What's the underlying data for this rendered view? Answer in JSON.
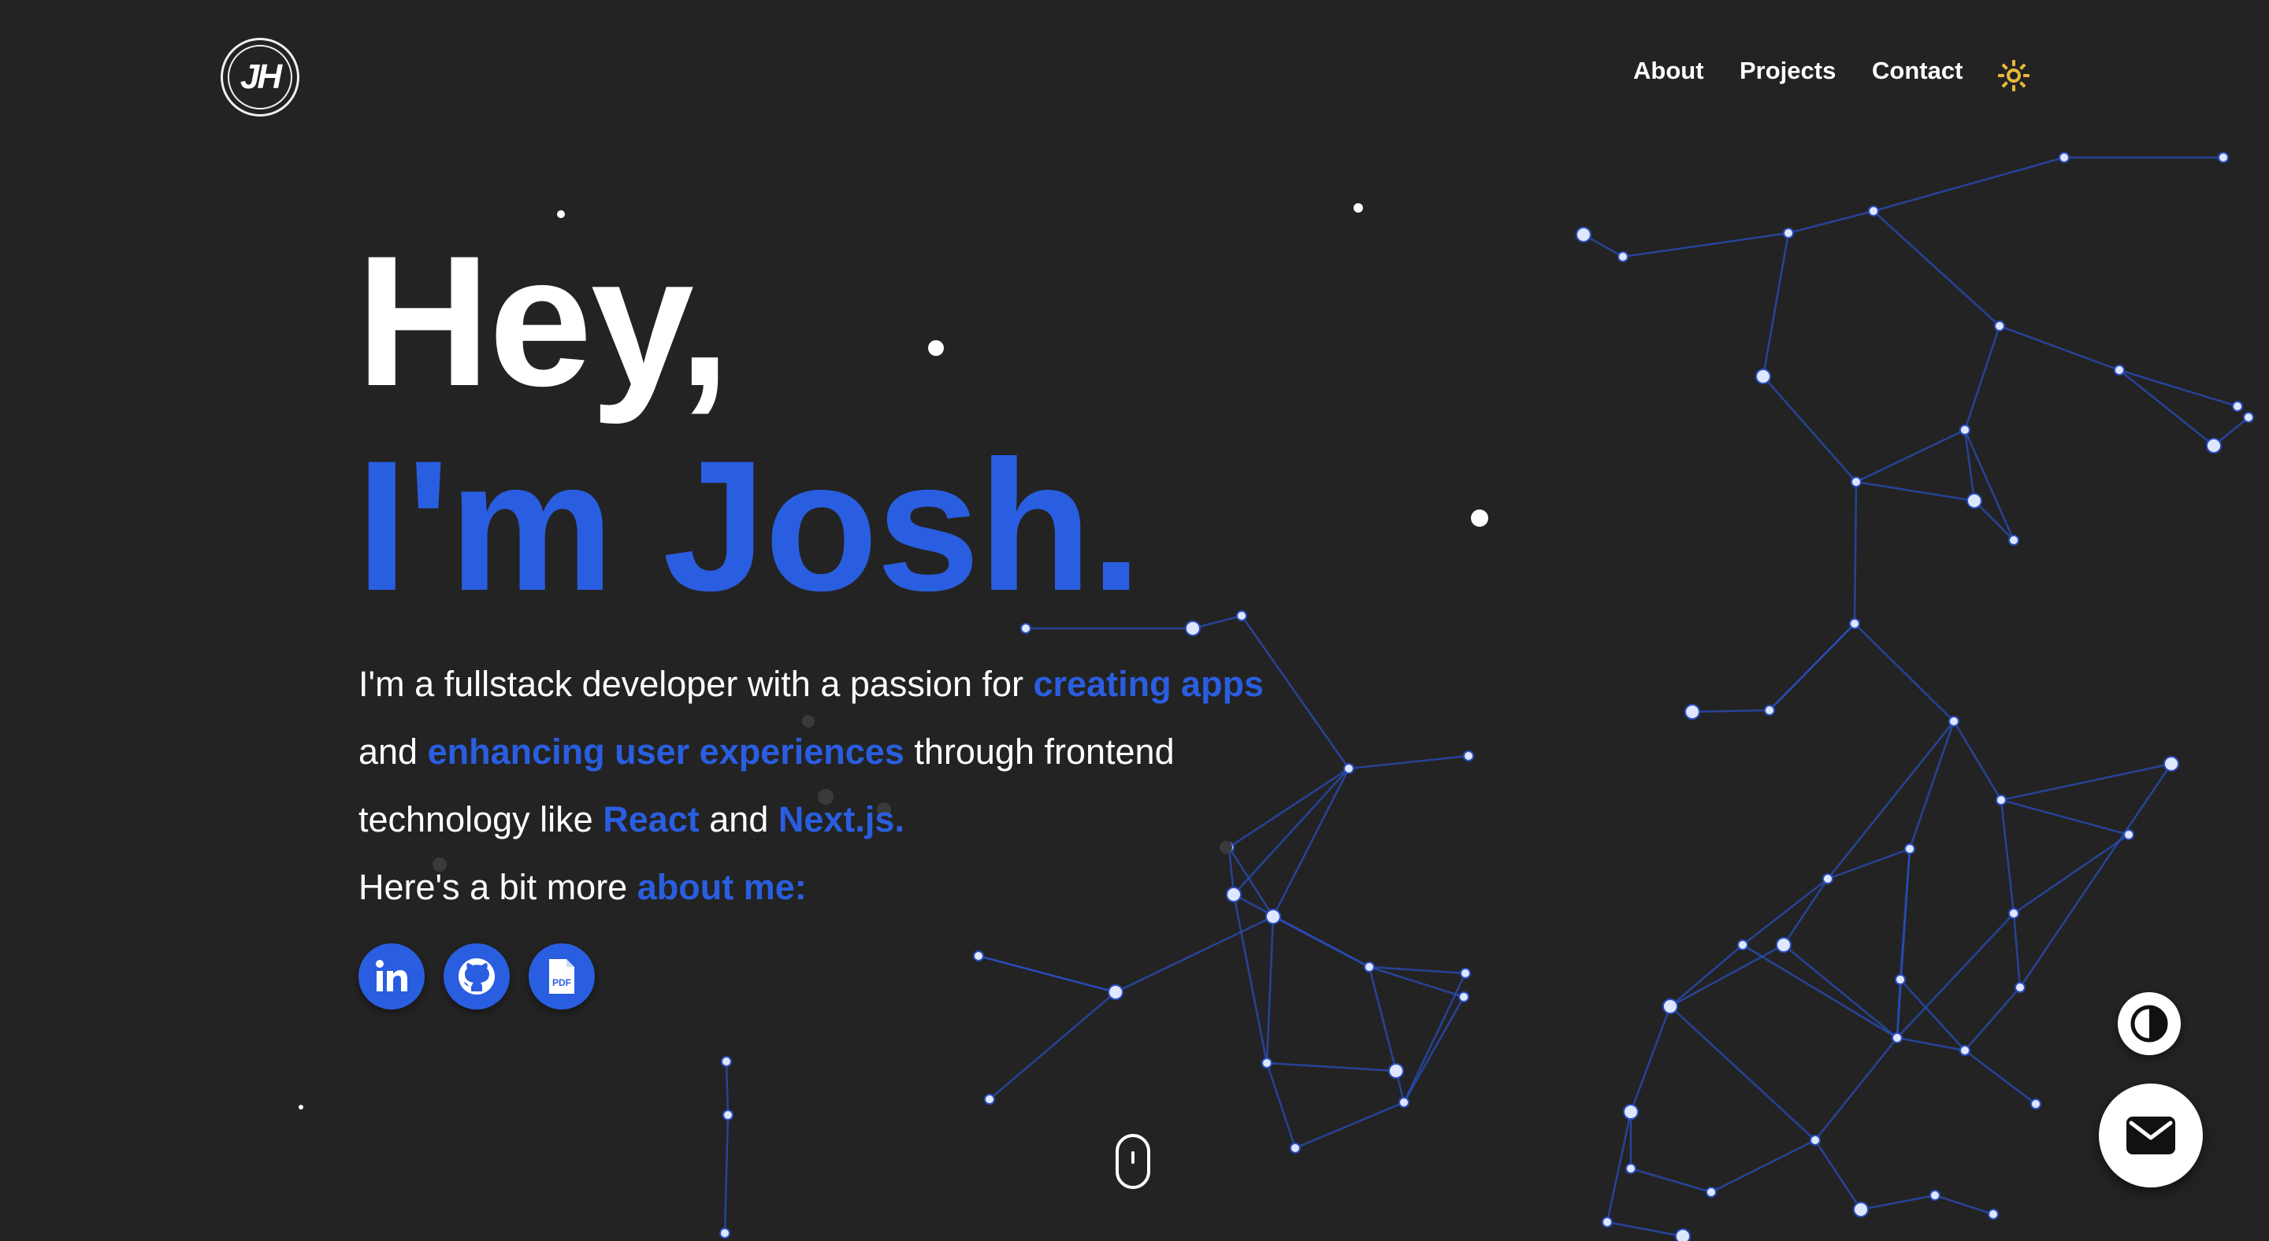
{
  "header": {
    "logo_text": "JH",
    "nav": [
      {
        "label": "About"
      },
      {
        "label": "Projects"
      },
      {
        "label": "Contact"
      }
    ],
    "theme_icon": "sun-icon"
  },
  "hero": {
    "line1": "Hey,",
    "line2": "I'm Josh.",
    "intro": {
      "t1": "I'm a fullstack developer with a passion for ",
      "h1": "creating apps",
      "t2": " and ",
      "h2": "enhancing user experiences",
      "t3": " through frontend technology like ",
      "h3": "React",
      "t4": " and ",
      "h4": "Next.js.",
      "t5": "Here's a bit more ",
      "h5": "about me:"
    }
  },
  "social": [
    {
      "icon": "linkedin-icon"
    },
    {
      "icon": "github-icon"
    },
    {
      "icon": "pdf-icon",
      "label": "PDF"
    }
  ],
  "floating": {
    "contrast_icon": "contrast-icon",
    "mail_icon": "mail-icon",
    "scroll_icon": "mouse-scroll-icon"
  },
  "colors": {
    "background": "#232323",
    "accent": "#2a5ee0",
    "text": "#ffffff",
    "sun": "#e8b93a",
    "network_line": "#2a4fc0",
    "network_node": "#dfe6ff"
  }
}
